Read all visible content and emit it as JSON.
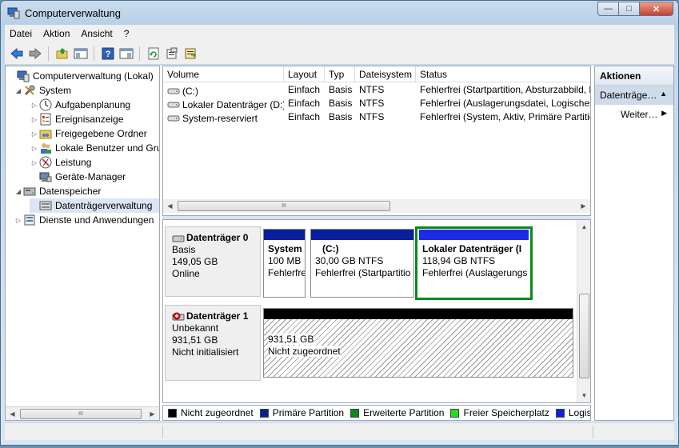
{
  "window": {
    "title": "Computerverwaltung"
  },
  "window_buttons": {
    "minimize": "—",
    "maximize": "□",
    "close": "✕"
  },
  "menu": [
    {
      "label": "Datei"
    },
    {
      "label": "Aktion"
    },
    {
      "label": "Ansicht"
    },
    {
      "label": "?"
    }
  ],
  "toolbar": {
    "buttons": [
      "back-icon",
      "forward-icon",
      "up-folder-icon",
      "show-tree-icon",
      "help-icon",
      "show-actions-icon",
      "refresh-icon",
      "properties-icon",
      "export-icon"
    ]
  },
  "tree": {
    "items": [
      {
        "label": "Computerverwaltung (Lokal)",
        "icon": "computer-management-icon",
        "indent": 0,
        "twisty": ""
      },
      {
        "label": "System",
        "icon": "tools-icon",
        "indent": 1,
        "twisty": "◢"
      },
      {
        "label": "Aufgabenplanung",
        "icon": "clock-icon",
        "indent": 2,
        "twisty": "▷"
      },
      {
        "label": "Ereignisanzeige",
        "icon": "event-viewer-icon",
        "indent": 2,
        "twisty": "▷"
      },
      {
        "label": "Freigegebene Ordner",
        "icon": "shared-folder-icon",
        "indent": 2,
        "twisty": "▷"
      },
      {
        "label": "Lokale Benutzer und Gruppen",
        "icon": "users-icon",
        "indent": 2,
        "twisty": "▷"
      },
      {
        "label": "Leistung",
        "icon": "performance-icon",
        "indent": 2,
        "twisty": "▷"
      },
      {
        "label": "Geräte-Manager",
        "icon": "device-manager-icon",
        "indent": 2,
        "twisty": ""
      },
      {
        "label": "Datenspeicher",
        "icon": "storage-icon",
        "indent": 1,
        "twisty": "◢"
      },
      {
        "label": "Datenträgerverwaltung",
        "icon": "disk-management-icon",
        "indent": 2,
        "twisty": "",
        "selected": true
      },
      {
        "label": "Dienste und Anwendungen",
        "icon": "services-icon",
        "indent": 1,
        "twisty": "▷"
      }
    ],
    "scroll_thumb": "III"
  },
  "volumes": {
    "columns": [
      "Volume",
      "Layout",
      "Typ",
      "Dateisystem",
      "Status"
    ],
    "rows": [
      {
        "volume": "(C:)",
        "layout": "Einfach",
        "typ": "Basis",
        "fs": "NTFS",
        "status": "Fehlerfrei (Startpartition, Absturzabbild, P"
      },
      {
        "volume": "Lokaler Datenträger (D:)",
        "layout": "Einfach",
        "typ": "Basis",
        "fs": "NTFS",
        "status": "Fehlerfrei (Auslagerungsdatei, Logisches"
      },
      {
        "volume": "System-reserviert",
        "layout": "Einfach",
        "typ": "Basis",
        "fs": "NTFS",
        "status": "Fehlerfrei (System, Aktiv, Primäre Partitic"
      }
    ],
    "scroll_thumb": "III"
  },
  "disks": [
    {
      "name": "Datenträger 0",
      "type": "Basis",
      "size": "149,05 GB",
      "state": "Online",
      "partitions": [
        {
          "name": "System",
          "size": "100 MB",
          "status": "Fehlerfre",
          "bar_color": "#0a1f9e"
        },
        {
          "name": "(C:)",
          "size": "30,00 GB NTFS",
          "status": "Fehlerfrei (Startpartitio",
          "bar_color": "#0a1f9e"
        },
        {
          "name": "Lokaler Datenträger (I",
          "size": "118,94 GB NTFS",
          "status": "Fehlerfrei (Auslagerungs",
          "bar_color": "#1a2ae6",
          "frame_color": "#0a8a1a"
        }
      ]
    },
    {
      "name": "Datenträger 1",
      "type": "Unbekannt",
      "size": "931,51 GB",
      "state": "Nicht initialisiert",
      "partitions": [
        {
          "size": "931,51 GB",
          "status": "Nicht zugeordnet",
          "bar_color": "#000000"
        }
      ]
    }
  ],
  "legend": [
    {
      "label": "Nicht zugeordnet",
      "color": "#000000"
    },
    {
      "label": "Primäre Partition",
      "color": "#0a1f8e"
    },
    {
      "label": "Erweiterte Partition",
      "color": "#0a8a1a"
    },
    {
      "label": "Freier Speicherplatz",
      "color": "#22dd22"
    },
    {
      "label": "Logische Laufwerke",
      "color": "#1020e8"
    }
  ],
  "actions": {
    "header": "Aktionen",
    "section": "Datenträgerverwaltung",
    "item": "Weitere Aktionen"
  }
}
